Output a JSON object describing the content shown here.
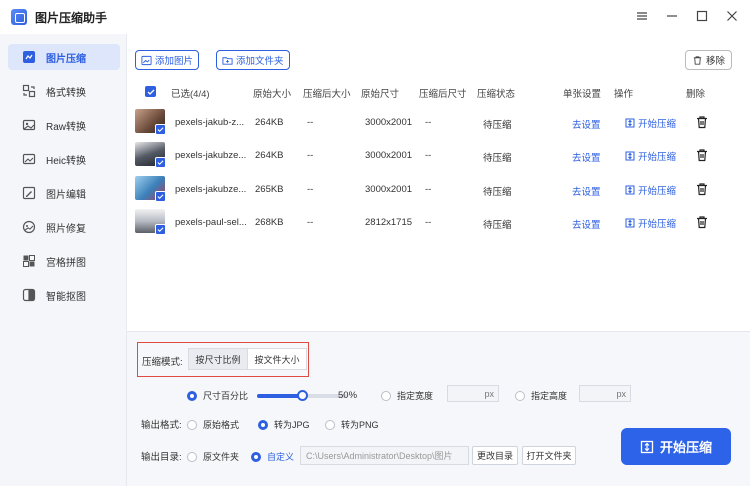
{
  "app": {
    "title": "图片压缩助手"
  },
  "window_controls": [
    "menu",
    "minimize",
    "maximize",
    "close"
  ],
  "sidebar": {
    "items": [
      {
        "label": "图片压缩",
        "icon": "compress-icon",
        "active": true
      },
      {
        "label": "格式转换",
        "icon": "convert-icon",
        "active": false
      },
      {
        "label": "Raw转换",
        "icon": "raw-icon",
        "active": false
      },
      {
        "label": "Heic转换",
        "icon": "heic-icon",
        "active": false
      },
      {
        "label": "图片编辑",
        "icon": "edit-icon",
        "active": false
      },
      {
        "label": "照片修复",
        "icon": "repair-icon",
        "active": false
      },
      {
        "label": "宫格拼图",
        "icon": "grid-icon",
        "active": false
      },
      {
        "label": "智能抠图",
        "icon": "cutout-icon",
        "active": false
      }
    ]
  },
  "toolbar": {
    "add_image": "添加图片",
    "add_folder": "添加文件夹",
    "remove": "移除"
  },
  "table": {
    "headers": {
      "selected": "已选(4/4)",
      "original_size": "原始大小",
      "compressed_size": "压缩后大小",
      "original_dims": "原始尺寸",
      "compressed_dims": "压缩后尺寸",
      "status": "压缩状态",
      "single_settings": "单张设置",
      "action": "操作",
      "delete": "删除"
    },
    "rows": [
      {
        "name": "pexels-jakub-z...",
        "original_size": "264KB",
        "compressed_size": "--",
        "original_dims": "3000x2001",
        "compressed_dims": "--",
        "status": "待压缩",
        "settings": "去设置",
        "action": "开始压缩",
        "thumb": "#7a5a4a"
      },
      {
        "name": "pexels-jakubze...",
        "original_size": "264KB",
        "compressed_size": "--",
        "original_dims": "3000x2001",
        "compressed_dims": "--",
        "status": "待压缩",
        "settings": "去设置",
        "action": "开始压缩",
        "thumb": "#3a3f48"
      },
      {
        "name": "pexels-jakubze...",
        "original_size": "265KB",
        "compressed_size": "--",
        "original_dims": "3000x2001",
        "compressed_dims": "--",
        "status": "待压缩",
        "settings": "去设置",
        "action": "开始压缩",
        "thumb": "#4a90c0"
      },
      {
        "name": "pexels-paul-sel...",
        "original_size": "268KB",
        "compressed_size": "--",
        "original_dims": "2812x1715",
        "compressed_dims": "--",
        "status": "待压缩",
        "settings": "去设置",
        "action": "开始压缩",
        "thumb": "#8a8f98"
      }
    ]
  },
  "settings": {
    "mode_label": "压缩模式:",
    "mode_options": [
      "按尺寸比例",
      "按文件大小"
    ],
    "mode_selected": "按尺寸比例",
    "size_percent_label": "尺寸百分比",
    "size_percent_value": "50%",
    "size_percent_fraction": 0.5,
    "fixed_width_label": "指定宽度",
    "fixed_height_label": "指定高度",
    "px_unit": "px",
    "output_format_label": "输出格式:",
    "format_options": [
      "原始格式",
      "转为JPG",
      "转为PNG"
    ],
    "format_selected": "转为JPG",
    "output_dir_label": "输出目录:",
    "dir_options": [
      "原文件夹",
      "自定义"
    ],
    "dir_selected": "自定义",
    "dir_path": "C:\\Users\\Administrator\\Desktop\\图片",
    "change_dir": "更改目录",
    "open_folder": "打开文件夹",
    "start_all": "开始压缩"
  },
  "colors": {
    "accent": "#2d5fe0",
    "highlight_border": "#e04b40"
  }
}
